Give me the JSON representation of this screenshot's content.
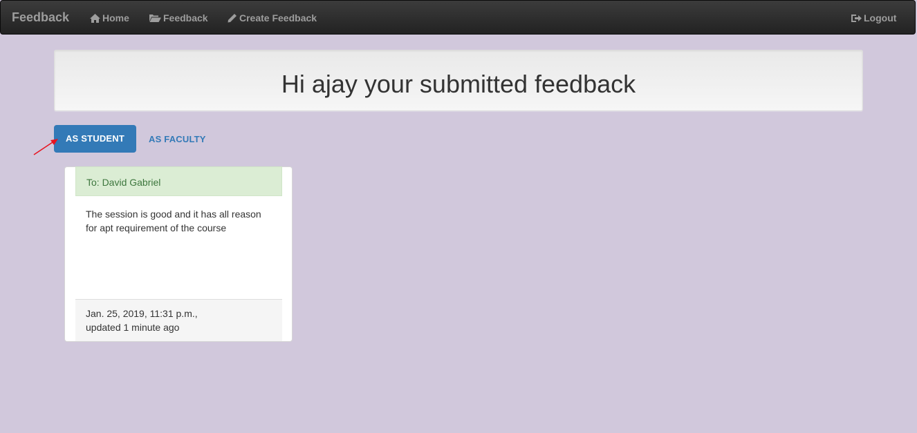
{
  "navbar": {
    "brand": "Feedback",
    "items": [
      {
        "label": "Home",
        "icon": "home-icon"
      },
      {
        "label": "Feedback",
        "icon": "folder-open-icon"
      },
      {
        "label": "Create Feedback",
        "icon": "pencil-icon"
      }
    ],
    "logout": {
      "label": "Logout",
      "icon": "logout-icon"
    }
  },
  "header": {
    "title": "Hi ajay your submitted feedback"
  },
  "tabs": {
    "student": "AS STUDENT",
    "faculty": "AS FACULTY"
  },
  "feedback_cards": [
    {
      "to": "To: David Gabriel",
      "body": "The session is good and it has all reason for apt requirement of the course",
      "date": "Jan. 25, 2019, 11:31 p.m.,",
      "updated": "updated 1 minute ago"
    }
  ],
  "colors": {
    "background": "#d1c8dc",
    "primary": "#337ab7",
    "success_bg": "#dbedd4",
    "success_text": "#3c763d",
    "annotation_arrow": "#e8131f"
  }
}
